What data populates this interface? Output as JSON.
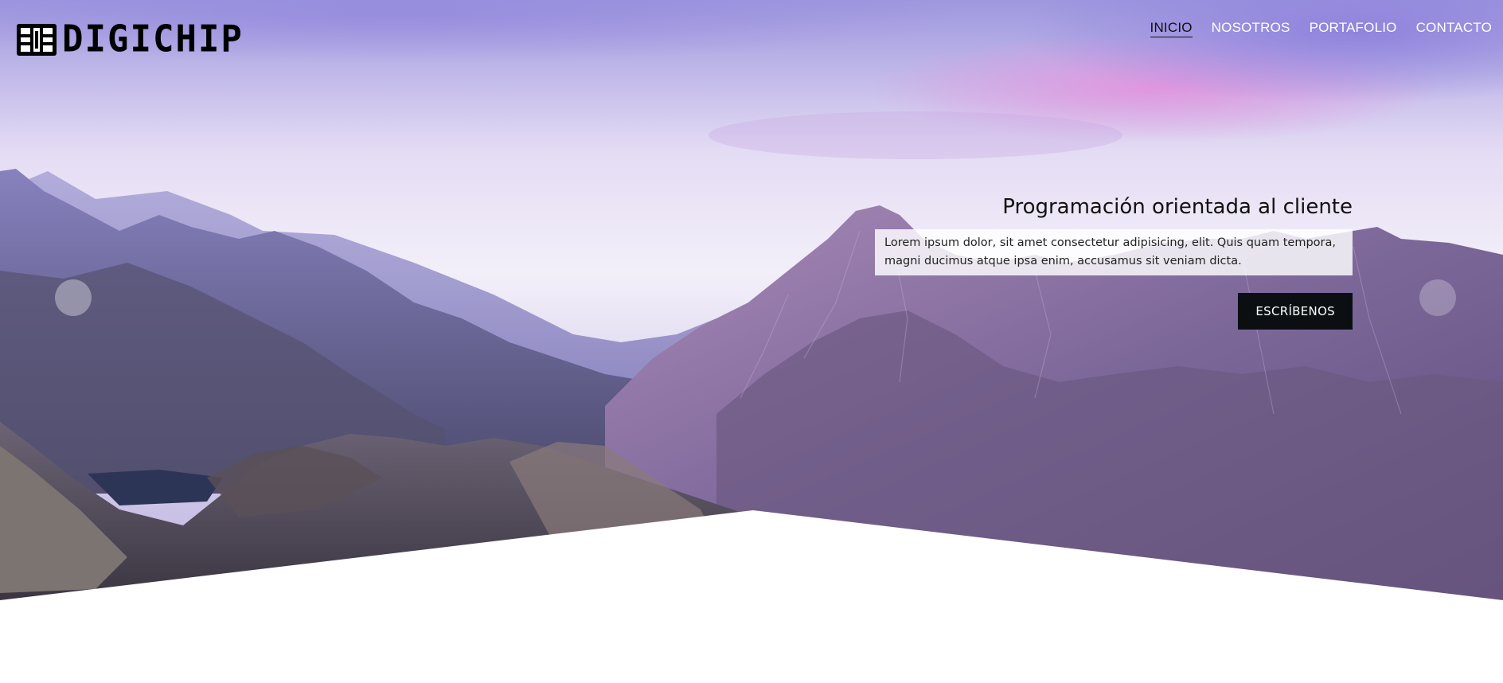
{
  "brand": {
    "name": "DIGICHIP"
  },
  "nav": {
    "items": [
      {
        "label": "INICIO",
        "active": true
      },
      {
        "label": "NOSOTROS",
        "active": false
      },
      {
        "label": "PORTAFOLIO",
        "active": false
      },
      {
        "label": "CONTACTO",
        "active": false
      }
    ]
  },
  "slide": {
    "title": "Programación orientada al cliente",
    "description": "Lorem ipsum dolor, sit amet consectetur adipisicing, elit. Quis quam tempora, magni ducimus atque ipsa enim, accusamus sit veniam dicta.",
    "cta_label": "ESCRÍBENOS"
  },
  "carousel": {
    "prev_icon": "chevron-left-icon",
    "next_icon": "chevron-right-icon"
  },
  "colors": {
    "sky_top": "#8f86dc",
    "sky_pink": "#e7a6e0",
    "mountain_purple": "#7f6aa3",
    "cta_bg": "#0b0f12"
  }
}
